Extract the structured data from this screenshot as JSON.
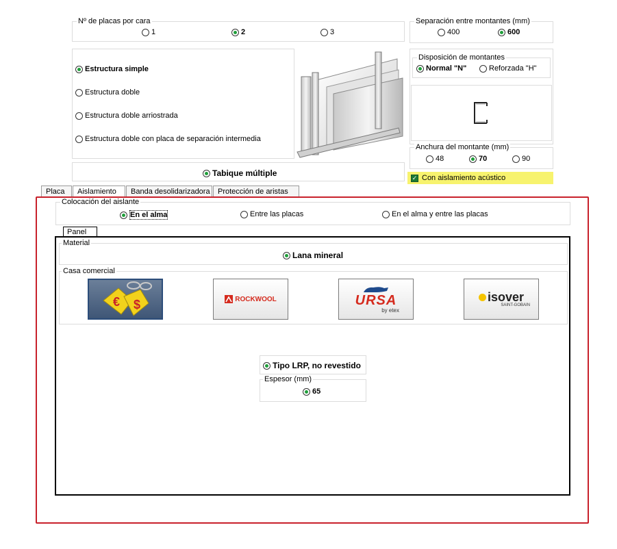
{
  "placas": {
    "legend": "Nº de placas por cara",
    "options": [
      "1",
      "2",
      "3"
    ],
    "selected": "2"
  },
  "separacion": {
    "legend": "Separación entre montantes (mm)",
    "options": [
      "400",
      "600"
    ],
    "selected": "600"
  },
  "estructura": {
    "options": [
      "Estructura simple",
      "Estructura doble",
      "Estructura doble arriostrada",
      "Estructura doble con placa de separación intermedia"
    ],
    "selected": "Estructura simple"
  },
  "disposicion": {
    "legend": "Disposición de montantes",
    "options": [
      "Normal \"N\"",
      "Reforzada \"H\""
    ],
    "selected": "Normal \"N\""
  },
  "anchura": {
    "legend": "Anchura del montante (mm)",
    "options": [
      "48",
      "70",
      "90"
    ],
    "selected": "70"
  },
  "aislamiento_acustico": {
    "label": "Con aislamiento acústico",
    "checked": true
  },
  "tabique": {
    "label": "Tabique múltiple",
    "selected": true
  },
  "tabs": [
    "Placa",
    "Aislamiento",
    "Banda desolidarizadora",
    "Protección de aristas"
  ],
  "active_tab": "Aislamiento",
  "colocacion": {
    "legend": "Colocación del aislante",
    "options": [
      "En el alma",
      "Entre las placas",
      "En el alma y entre las placas"
    ],
    "selected": "En el alma"
  },
  "panel_tab": "Panel",
  "material": {
    "legend": "Material",
    "option": "Lana mineral"
  },
  "casa": {
    "legend": "Casa comercial",
    "brands": [
      {
        "name": "generic-price",
        "symbol_e": "€",
        "symbol_d": "$"
      },
      {
        "name": "rockwool",
        "label": "ROCKWOOL"
      },
      {
        "name": "ursa",
        "label": "URSA",
        "sub": "by etex"
      },
      {
        "name": "isover",
        "label": "ISOVER",
        "sub": "SAINT-GOBAIN"
      }
    ]
  },
  "tipo": {
    "label": "Tipo LRP, no revestido"
  },
  "espesor": {
    "legend": "Espesor (mm)",
    "value": "65"
  },
  "colors": {
    "radio_on": "#1f9e3a",
    "highlight": "#f7f36e",
    "frame_red": "#c8202a",
    "check_green": "#1d7a34"
  }
}
